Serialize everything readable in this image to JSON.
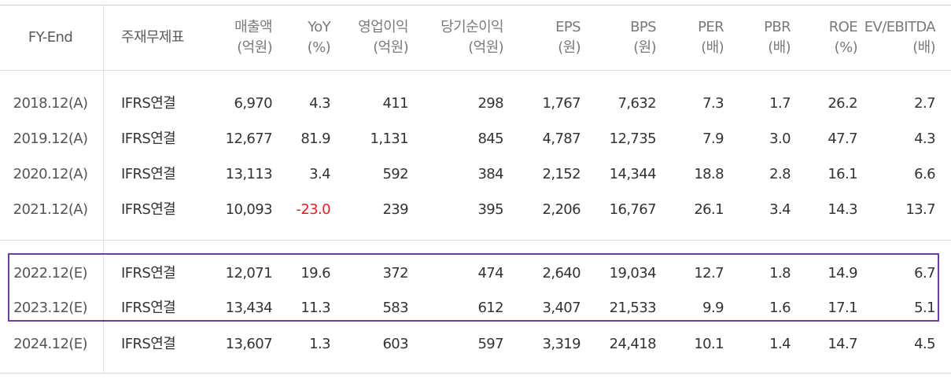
{
  "columns": [
    {
      "title": "FY-End",
      "unit": ""
    },
    {
      "title": "주재무제표",
      "unit": ""
    },
    {
      "title": "매출액",
      "unit": "(억원)"
    },
    {
      "title": "YoY",
      "unit": "(%)"
    },
    {
      "title": "영업이익",
      "unit": "(억원)"
    },
    {
      "title": "당기순이익",
      "unit": "(억원)"
    },
    {
      "title": "EPS",
      "unit": "(원)"
    },
    {
      "title": "BPS",
      "unit": "(원)"
    },
    {
      "title": "PER",
      "unit": "(배)"
    },
    {
      "title": "PBR",
      "unit": "(배)"
    },
    {
      "title": "ROE",
      "unit": "(%)"
    },
    {
      "title": "EV/EBITDA",
      "unit": "(배)"
    }
  ],
  "rows": [
    {
      "fy": "2018.12(A)",
      "stmt": "IFRS연결",
      "sales": "6,970",
      "yoy": "4.3",
      "op": "411",
      "net": "298",
      "eps": "1,767",
      "bps": "7,632",
      "per": "7.3",
      "pbr": "1.7",
      "roe": "26.2",
      "ev": "2.7"
    },
    {
      "fy": "2019.12(A)",
      "stmt": "IFRS연결",
      "sales": "12,677",
      "yoy": "81.9",
      "op": "1,131",
      "net": "845",
      "eps": "4,787",
      "bps": "12,735",
      "per": "7.9",
      "pbr": "3.0",
      "roe": "47.7",
      "ev": "4.3"
    },
    {
      "fy": "2020.12(A)",
      "stmt": "IFRS연결",
      "sales": "13,113",
      "yoy": "3.4",
      "op": "592",
      "net": "384",
      "eps": "2,152",
      "bps": "14,344",
      "per": "18.8",
      "pbr": "2.8",
      "roe": "16.1",
      "ev": "6.6"
    },
    {
      "fy": "2021.12(A)",
      "stmt": "IFRS연결",
      "sales": "10,093",
      "yoy": "-23.0",
      "op": "239",
      "net": "395",
      "eps": "2,206",
      "bps": "16,767",
      "per": "26.1",
      "pbr": "3.4",
      "roe": "14.3",
      "ev": "13.7"
    },
    {
      "fy": "2022.12(E)",
      "stmt": "IFRS연결",
      "sales": "12,071",
      "yoy": "19.6",
      "op": "372",
      "net": "474",
      "eps": "2,640",
      "bps": "19,034",
      "per": "12.7",
      "pbr": "1.8",
      "roe": "14.9",
      "ev": "6.7"
    },
    {
      "fy": "2023.12(E)",
      "stmt": "IFRS연결",
      "sales": "13,434",
      "yoy": "11.3",
      "op": "583",
      "net": "612",
      "eps": "3,407",
      "bps": "21,533",
      "per": "9.9",
      "pbr": "1.6",
      "roe": "17.1",
      "ev": "5.1"
    },
    {
      "fy": "2024.12(E)",
      "stmt": "IFRS연결",
      "sales": "13,607",
      "yoy": "1.3",
      "op": "603",
      "net": "597",
      "eps": "3,319",
      "bps": "24,418",
      "per": "10.1",
      "pbr": "1.4",
      "roe": "14.7",
      "ev": "4.5"
    }
  ],
  "colors": {
    "negative": "#e41e26",
    "highlight_border": "#6a3fa0",
    "rule": "#d9d9d9"
  }
}
